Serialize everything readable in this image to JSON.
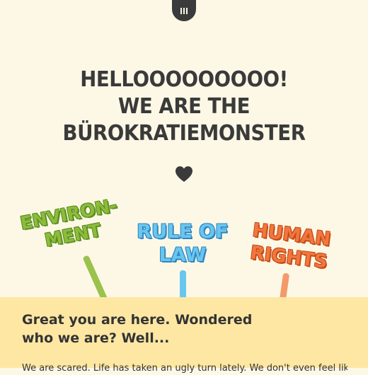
{
  "menu": {
    "icon": "menu-bars-icon"
  },
  "hero": {
    "line1": "HELLOOOOOOOOO!",
    "line2": "WE ARE THE",
    "line3": "BÜROKRATIEMONSTER",
    "heart_icon": "heart-icon",
    "heart_color": "#3a3a3a"
  },
  "signs": [
    {
      "line1": "ENVIRON-",
      "line2": "MENT",
      "color": "#8dbb3c"
    },
    {
      "line1": "RULE OF",
      "line2": "LAW",
      "color": "#6ac6ee"
    },
    {
      "line1": "HUMAN",
      "line2": "RIGHTS",
      "color": "#f0773f"
    }
  ],
  "intro": {
    "title": "Great you are here. Wondered who we are? Well...",
    "body": "We are scared. Life has taken an ugly turn lately. We don't even feel like",
    "background": "#fde7a3"
  },
  "colors": {
    "background": "#fdf8e6",
    "text": "#3a3a3a"
  }
}
